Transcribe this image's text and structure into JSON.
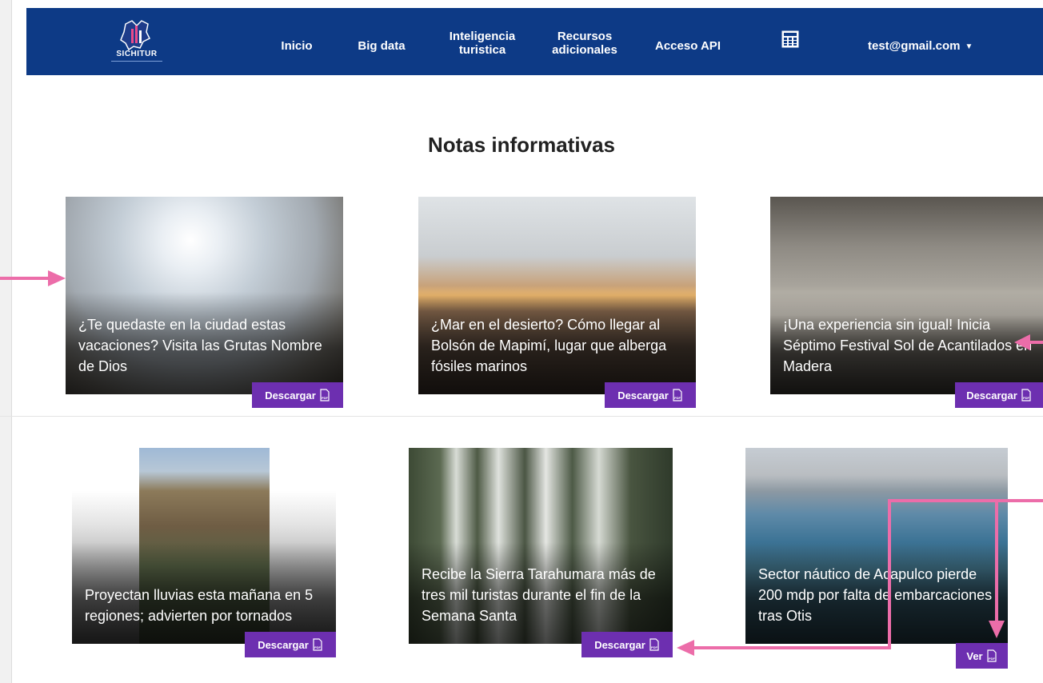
{
  "header": {
    "logo_text": "SICHITUR",
    "nav": [
      {
        "label": "Inicio"
      },
      {
        "label": "Big data"
      },
      {
        "label": "Inteligencia turistica"
      },
      {
        "label": "Recursos adicionales"
      },
      {
        "label": "Acceso API"
      }
    ],
    "user_email": "test@gmail.com"
  },
  "page": {
    "title": "Notas informativas"
  },
  "cards": [
    {
      "caption": "¿Te quedaste en la ciudad estas vacaciones? Visita las Grutas Nombre de Dios",
      "button": "Descargar"
    },
    {
      "caption": "¿Mar en el desierto? Cómo llegar al Bolsón de Mapimí, lugar que alberga fósiles marinos",
      "button": "Descargar"
    },
    {
      "caption": "¡Una experiencia sin igual! Inicia Séptimo Festival Sol de Acantilados en Madera",
      "button": "Descargar"
    },
    {
      "caption": "Proyectan lluvias esta mañana en 5 regiones; advierten por tornados",
      "button": "Descargar"
    },
    {
      "caption": "Recibe la Sierra Tarahumara más de tres mil turistas durante el fin de la Semana Santa",
      "button": "Descargar"
    },
    {
      "caption": "Sector náutico de Acapulco pierde 200 mdp por falta de embarcaciones tras Otis",
      "button": "Ver"
    }
  ],
  "colors": {
    "navbar": "#0d3a86",
    "button": "#6d2fb0",
    "annotation_arrow": "#ec6da9"
  }
}
